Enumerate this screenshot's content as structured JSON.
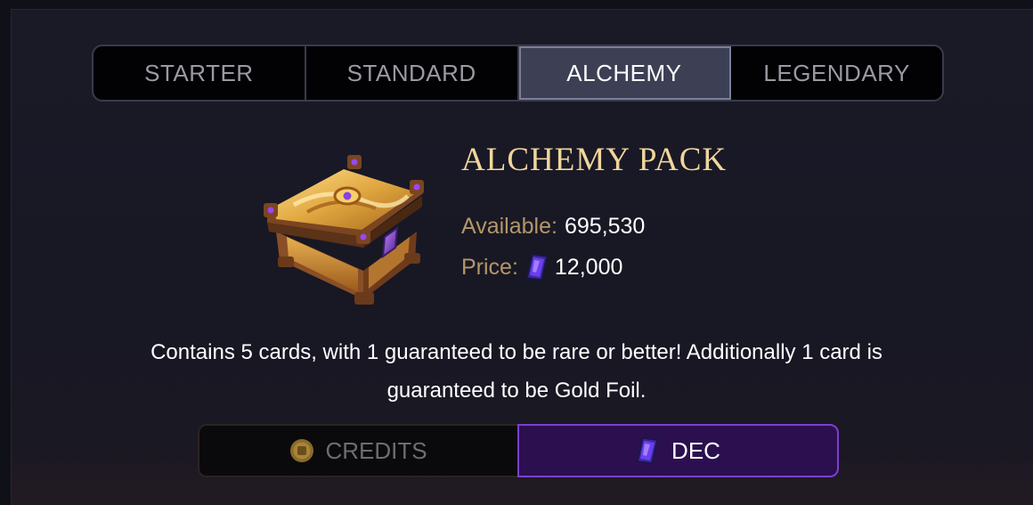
{
  "tabs": [
    {
      "label": "STARTER",
      "active": false
    },
    {
      "label": "STANDARD",
      "active": false
    },
    {
      "label": "ALCHEMY",
      "active": true
    },
    {
      "label": "LEGENDARY",
      "active": false
    }
  ],
  "pack": {
    "title": "ALCHEMY PACK",
    "image_icon": "treasure-chest",
    "available_label": "Available:",
    "available_value": "695,530",
    "price_label": "Price:",
    "price_icon": "dec-gem",
    "price_value": "12,000",
    "description_line1": "Contains 5 cards, with 1 guaranteed to be rare or better! Additionally 1 card is",
    "description_line2": "guaranteed to be Gold Foil."
  },
  "currency": {
    "selected": "DEC",
    "options": [
      {
        "label": "CREDITS",
        "icon": "credits-coin",
        "selected": false
      },
      {
        "label": "DEC",
        "icon": "dec-gem",
        "selected": true
      }
    ]
  },
  "colors": {
    "title_gold": "#f0d69a",
    "label_tan": "#b49668",
    "active_tab": "#3d3f55",
    "dec_purple": "#2b0f4f",
    "dec_border": "#7b3fd0"
  }
}
